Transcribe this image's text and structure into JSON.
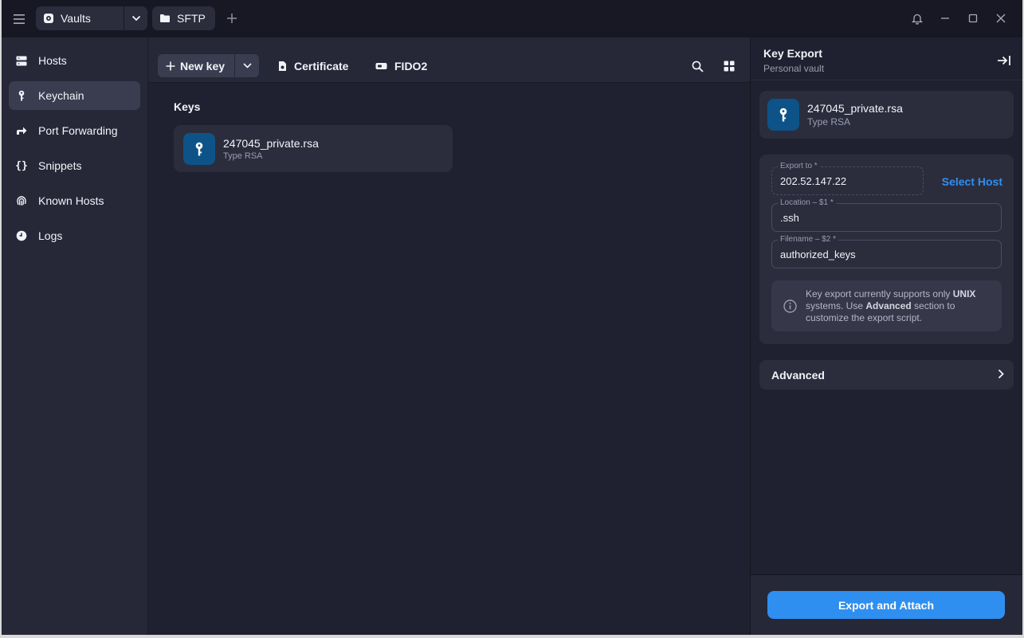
{
  "titlebar": {
    "vault_tab": "Vaults",
    "sftp_tab": "SFTP"
  },
  "sidebar": {
    "items": [
      {
        "label": "Hosts",
        "icon": "hosts-icon"
      },
      {
        "label": "Keychain",
        "icon": "key-icon",
        "active": true
      },
      {
        "label": "Port Forwarding",
        "icon": "port-forwarding-icon"
      },
      {
        "label": "Snippets",
        "icon": "snippets-icon"
      },
      {
        "label": "Known Hosts",
        "icon": "fingerprint-icon"
      },
      {
        "label": "Logs",
        "icon": "clock-icon"
      }
    ]
  },
  "toolbar": {
    "new_key_label": "New key",
    "certificate_label": "Certificate",
    "fido2_label": "FIDO2"
  },
  "keys_section": {
    "title": "Keys",
    "items": [
      {
        "name": "247045_private.rsa",
        "type": "Type RSA"
      }
    ]
  },
  "panel": {
    "title": "Key Export",
    "subtitle": "Personal vault",
    "key": {
      "name": "247045_private.rsa",
      "type": "Type RSA"
    },
    "export_to": {
      "label": "Export to *",
      "value": "202.52.147.22"
    },
    "select_host_label": "Select Host",
    "location": {
      "label": "Location – $1 *",
      "value": ".ssh"
    },
    "filename": {
      "label": "Filename – $2 *",
      "value": "authorized_keys"
    },
    "notice": {
      "part1": "Key export currently supports only ",
      "bold1": "UNIX",
      "part2": " systems. Use ",
      "bold2": "Advanced",
      "part3": " section to customize the export script."
    },
    "advanced_label": "Advanced",
    "export_button": "Export and Attach"
  },
  "colors": {
    "accent": "#2f8ff0",
    "background": "#1f2130",
    "sidebar": "#262838",
    "card": "#2b2d3d",
    "key_avatar": "#0d5388"
  }
}
